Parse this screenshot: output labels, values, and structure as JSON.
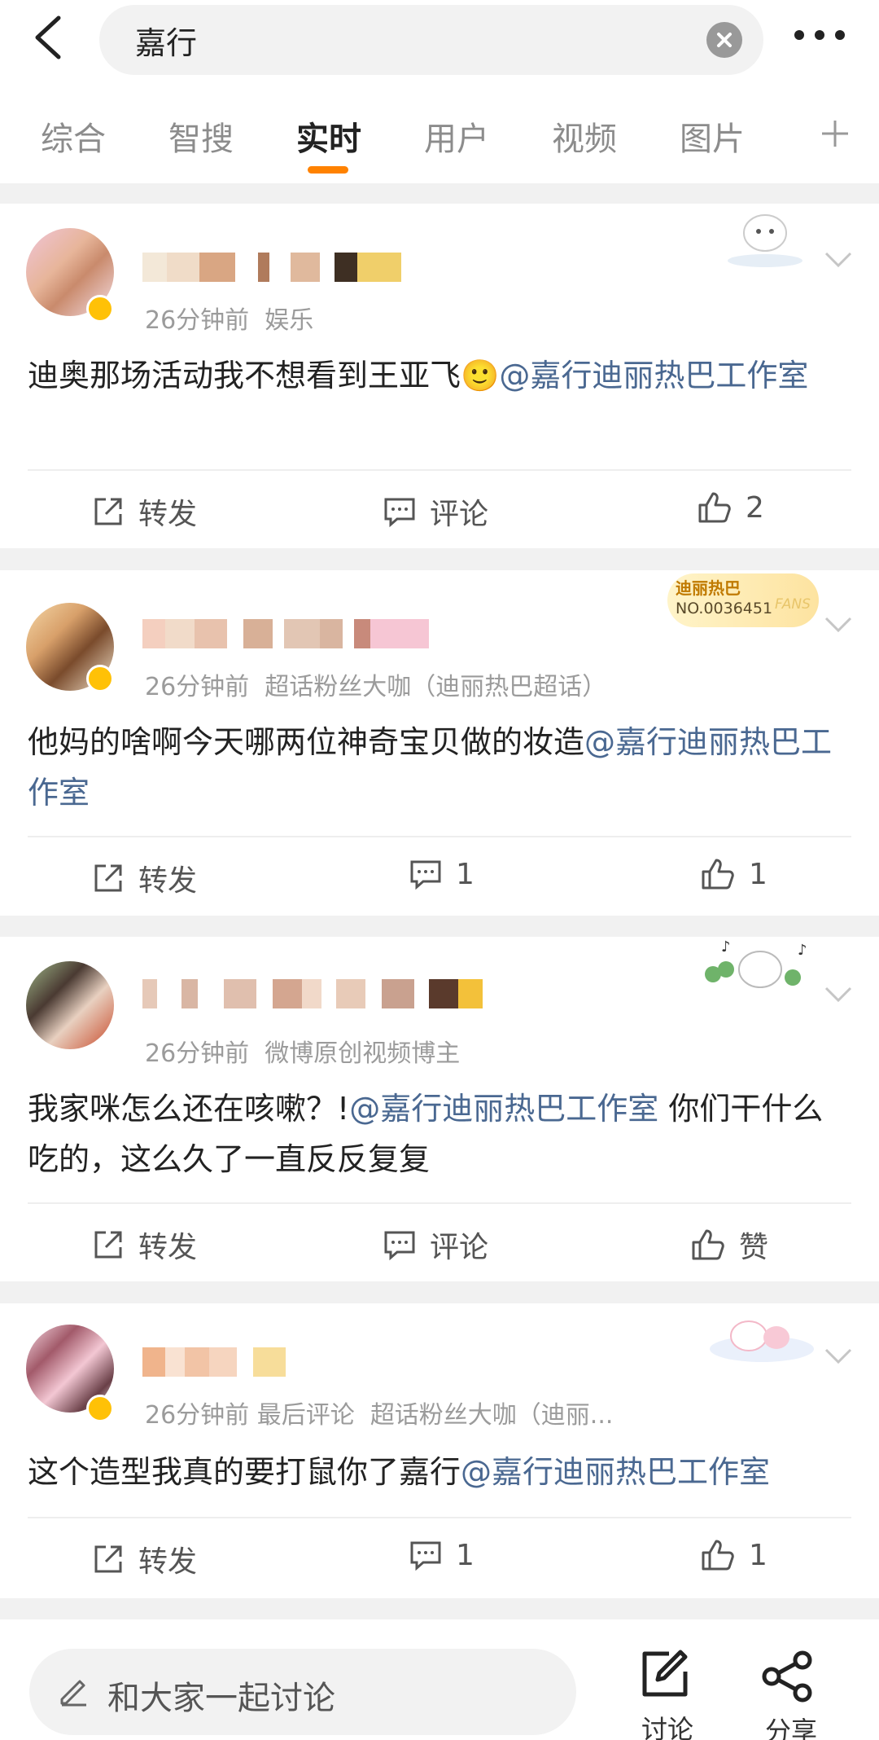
{
  "search": {
    "query": "嘉行"
  },
  "tabs": [
    {
      "label": "综合"
    },
    {
      "label": "智搜"
    },
    {
      "label": "实时"
    },
    {
      "label": "用户"
    },
    {
      "label": "视频"
    },
    {
      "label": "图片"
    }
  ],
  "active_tab": "实时",
  "accent_color": "#ff8200",
  "mention_color": "#4a6891",
  "posts": [
    {
      "time": "26分钟前",
      "source": "娱乐",
      "content": "迪奥那场活动我不想看到王亚飞",
      "emoji": "🙂",
      "mention": "@嘉行迪丽热巴工作室",
      "content_after": "",
      "actions": {
        "repost": "转发",
        "comment": "评论",
        "like": "2"
      }
    },
    {
      "time": "26分钟前",
      "source": "超话粉丝大咖（迪丽热巴超话）",
      "badge_title": "迪丽热巴",
      "badge_no": "NO.0036451",
      "badge_fans": "FANS",
      "content": "他妈的啥啊今天哪两位神奇宝贝做的妆造",
      "mention": "@嘉行迪丽热巴工作室",
      "content_after": "",
      "actions": {
        "repost": "转发",
        "comment": "1",
        "like": "1"
      }
    },
    {
      "time": "26分钟前",
      "source": "微博原创视频博主",
      "content": "我家咪怎么还在咳嗽？!",
      "mention": "@嘉行迪丽热巴工作室",
      "content_after": " 你们干什么吃的，这么久了一直反反复复",
      "actions": {
        "repost": "转发",
        "comment": "评论",
        "like": "赞"
      }
    },
    {
      "time": "26分钟前",
      "source": "最后评论",
      "source2": "超话粉丝大咖（迪丽...",
      "content": "这个造型我真的要打鼠你了嘉行",
      "mention": "@嘉行迪丽热巴工作室",
      "content_after": "",
      "actions": {
        "repost": "转发",
        "comment": "1",
        "like": "1"
      }
    }
  ],
  "bottom": {
    "input_placeholder": "和大家一起讨论",
    "discuss_label": "讨论",
    "share_label": "分享"
  }
}
